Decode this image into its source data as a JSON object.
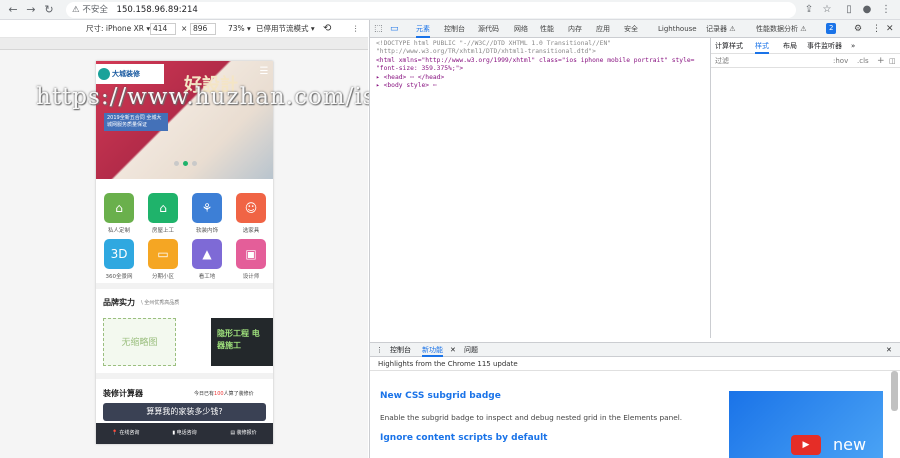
{
  "browser": {
    "security_label": "不安全",
    "url": "150.158.96.89:214"
  },
  "device_toolbar": {
    "size_label": "尺寸: iPhone XR ▾",
    "width": "414",
    "times": "×",
    "height": "896",
    "zoom": "73% ▾",
    "throttle": "已停用节流模式 ▾"
  },
  "phone": {
    "logo": "大城装修",
    "banner_title": "好設計",
    "banner_sub": "2019全新五合同 全城大城网服务质量保证",
    "grid": [
      {
        "label": "私人定制",
        "color": "#6ab04c",
        "icon": "home-outline-icon"
      },
      {
        "label": "房屋上工",
        "color": "#1fb36b",
        "icon": "house-icon"
      },
      {
        "label": "软装内饰",
        "color": "#3d7fd6",
        "icon": "sofa-icon"
      },
      {
        "label": "选家具",
        "color": "#f06445",
        "icon": "person-icon"
      },
      {
        "label": "360全景网",
        "color": "#2fa8e0",
        "icon": "3d-icon"
      },
      {
        "label": "分期小区",
        "color": "#f5a623",
        "icon": "wallet-icon"
      },
      {
        "label": "看工地",
        "color": "#7e6ad6",
        "icon": "hardhat-icon"
      },
      {
        "label": "设计师",
        "color": "#e45e99",
        "icon": "image-icon"
      }
    ],
    "brand_title": "品牌实力",
    "brand_sub": "\\ 全州优秀高品质",
    "card1_text": "无缩略图",
    "card2_text": "隐形工程 电器施工",
    "calc_title": "装修计算器",
    "calc_prefix": "今日已有",
    "calc_count": "100",
    "calc_suffix": "人算了装修价",
    "calc_button": "算算我的家装多少钱?",
    "footer": [
      "在线咨询",
      "电话咨询",
      "装修报价"
    ]
  },
  "watermark": "https://www.huzhan.com/ishop7751",
  "devtools": {
    "tabs": [
      "元素",
      "控制台",
      "源代码",
      "网络",
      "性能",
      "内存",
      "应用",
      "安全",
      "Lighthouse",
      "记录器 ⚠",
      "性能数据分析 ⚠"
    ],
    "badge": "2",
    "elements_lines": [
      {
        "kind": "gray",
        "text": "<!DOCTYPE html PUBLIC \"-//W3C//DTD XHTML 1.0 Transitional//EN\""
      },
      {
        "kind": "gray",
        "text": "\"http://www.w3.org/TR/xhtml1/DTD/xhtml1-transitional.dtd\">"
      },
      {
        "kind": "html",
        "text": "<html xmlns=\"http://www.w3.org/1999/xhtml\" class=\"ios iphone mobile portrait\" style="
      },
      {
        "kind": "html",
        "text": "\"font-size: 359.375%;\">"
      },
      {
        "kind": "html",
        "text": "▸ <head> ⋯ </head>"
      },
      {
        "kind": "html",
        "text": "▸ <body style> ⋯"
      }
    ],
    "styles_tabs": [
      "计算样式",
      "样式",
      "布局",
      "事件监听器",
      "»"
    ],
    "filter_placeholder": "过滤",
    "filter_hov": ":hov",
    "filter_cls": ".cls",
    "drawer_tabs": [
      "控制台",
      "新功能",
      "问题"
    ],
    "drawer_subtitle": "Highlights from the Chrome 115 update",
    "news": [
      {
        "title": "New CSS subgrid badge",
        "text": "Enable the subgrid badge to inspect and debug nested grid in the Elements panel."
      },
      {
        "title": "Ignore content scripts by default",
        "text": ""
      }
    ],
    "promo_word": "new"
  }
}
